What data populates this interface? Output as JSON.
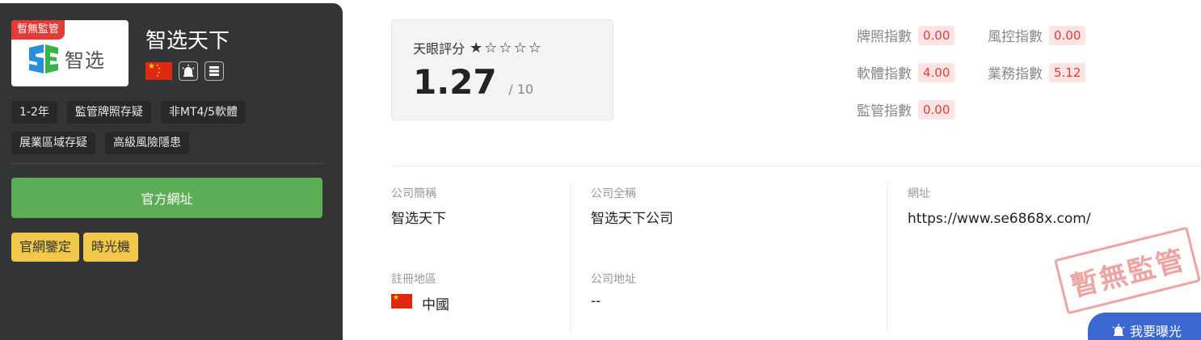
{
  "broker": {
    "name": "智选天下",
    "logo_text": "智选",
    "regulation_badge": "暫無監管",
    "tags": [
      "1-2年",
      "監管牌照存疑",
      "非MT4/5軟體",
      "展業區域存疑",
      "高級風險隱患"
    ],
    "official_site_button": "官方網址",
    "site_verify_button": "官網鑒定",
    "time_machine_button": "時光機"
  },
  "score": {
    "label": "天眼評分",
    "value": "1.27",
    "denominator": "/ 10",
    "stars_filled": 1,
    "stars_total": 5
  },
  "indices": [
    {
      "label": "牌照指數",
      "value": "0.00"
    },
    {
      "label": "風控指數",
      "value": "0.00"
    },
    {
      "label": "軟體指數",
      "value": "4.00"
    },
    {
      "label": "業務指數",
      "value": "5.12"
    },
    {
      "label": "監管指數",
      "value": "0.00"
    }
  ],
  "info": {
    "trade_name_label": "公司簡稱",
    "trade_name": "智选天下",
    "full_name_label": "公司全稱",
    "full_name": "智选天下公司",
    "website_label": "網址",
    "website": "https://www.se6868x.com/",
    "region_label": "註冊地區",
    "region": "中國",
    "address_label": "公司地址",
    "address": "--"
  },
  "stamp_text": "暫無監管",
  "expose_button": "我要曝光",
  "colors": {
    "dark_panel": "#333435",
    "green_button": "#5cad55",
    "yellow_button": "#f2c84b",
    "red_badge": "#e33b36",
    "blue_button": "#3a67d0"
  }
}
